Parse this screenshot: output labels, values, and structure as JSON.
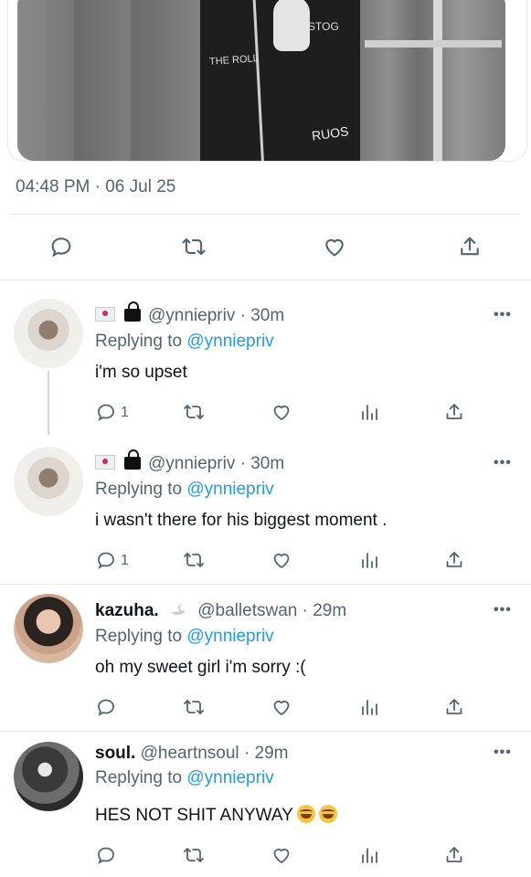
{
  "tweet": {
    "timestamp": "04:48 PM · 06 Jul 25",
    "photo_text": [
      "THE ROLL",
      "STOG",
      "RUOS"
    ]
  },
  "replies": [
    {
      "handle": "@ynniepriv",
      "time": "· 30m",
      "replying_prefix": "Replying to",
      "replying_to": "@ynniepriv",
      "text": "i'm so upset",
      "reply_count": "1"
    },
    {
      "handle": "@ynniepriv",
      "time": "· 30m",
      "replying_prefix": "Replying to",
      "replying_to": "@ynniepriv",
      "text": "i wasn't there for his biggest moment .",
      "reply_count": "1"
    },
    {
      "name": "kazuha.",
      "handle": "@balletswan",
      "time": "· 29m",
      "replying_prefix": "Replying to",
      "replying_to": "@ynniepriv",
      "text": "oh my sweet girl i'm sorry :("
    },
    {
      "name": "soul.",
      "handle": "@heartnsoul",
      "time": "· 29m",
      "replying_prefix": "Replying to",
      "replying_to": "@ynniepriv",
      "text": "HES NOT SHIT ANYWAY"
    }
  ],
  "icons": {
    "reply": "reply-icon",
    "retweet": "retweet-icon",
    "like": "like-icon",
    "analytics": "analytics-icon",
    "share": "share-icon",
    "more": "more-icon"
  },
  "more_label": "•••",
  "colors": {
    "link": "#1d9bf0",
    "secondary": "#536471",
    "separator": "#e6e9ec"
  }
}
